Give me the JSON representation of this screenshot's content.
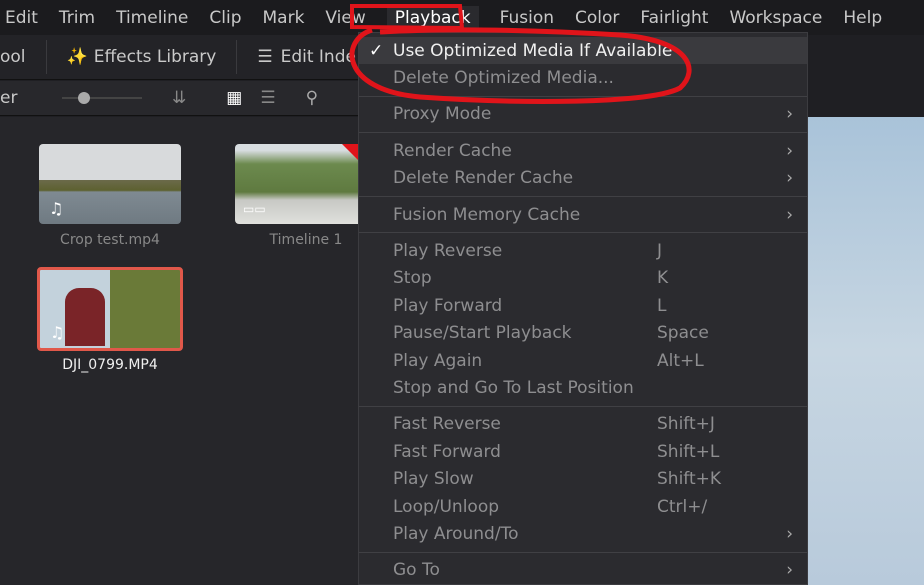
{
  "menubar": [
    "Edit",
    "Trim",
    "Timeline",
    "Clip",
    "Mark",
    "View",
    "Playback",
    "Fusion",
    "Color",
    "Fairlight",
    "Workspace",
    "Help"
  ],
  "toolbar": {
    "tool_partial": "ool",
    "effects": "Effects Library",
    "edit_index": "Edit Inde"
  },
  "subbar": {
    "label_partial": "er"
  },
  "media": [
    {
      "name": "Crop test.mp4"
    },
    {
      "name": "Timeline 1"
    },
    {
      "name": "DJI_0799.MP4",
      "selected": true
    }
  ],
  "menu": {
    "groups": [
      [
        {
          "label": "Use Optimized Media If Available",
          "checked": true,
          "enabled": true
        },
        {
          "label": "Delete Optimized Media..."
        }
      ],
      [
        {
          "label": "Proxy Mode",
          "submenu": true
        }
      ],
      [
        {
          "label": "Render Cache",
          "submenu": true
        },
        {
          "label": "Delete Render Cache",
          "submenu": true
        }
      ],
      [
        {
          "label": "Fusion Memory Cache",
          "submenu": true
        }
      ],
      [
        {
          "label": "Play Reverse",
          "shortcut": "J"
        },
        {
          "label": "Stop",
          "shortcut": "K"
        },
        {
          "label": "Play Forward",
          "shortcut": "L"
        },
        {
          "label": "Pause/Start Playback",
          "shortcut": "Space"
        },
        {
          "label": "Play Again",
          "shortcut": "Alt+L"
        },
        {
          "label": "Stop and Go To Last Position"
        }
      ],
      [
        {
          "label": "Fast Reverse",
          "shortcut": "Shift+J"
        },
        {
          "label": "Fast Forward",
          "shortcut": "Shift+L"
        },
        {
          "label": "Play Slow",
          "shortcut": "Shift+K"
        },
        {
          "label": "Loop/Unloop",
          "shortcut": "Ctrl+/"
        },
        {
          "label": "Play Around/To",
          "submenu": true
        }
      ],
      [
        {
          "label": "Go To",
          "submenu": true
        }
      ]
    ]
  },
  "colors": {
    "annotation": "#e0141a",
    "selection": "#e0584a"
  }
}
